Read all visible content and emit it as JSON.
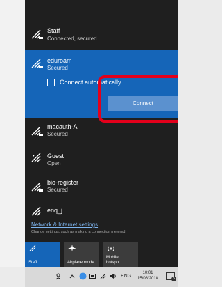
{
  "networks": [
    {
      "name": "Staff",
      "status": "Connected, secured"
    },
    {
      "name": "eduroam",
      "status": "Secured",
      "selected": true
    },
    {
      "name": "macauth-A",
      "status": "Secured"
    },
    {
      "name": "Guest",
      "status": "Open"
    },
    {
      "name": "bio-register",
      "status": "Secured"
    },
    {
      "name": "enq_j",
      "status": ""
    }
  ],
  "eduroam_panel": {
    "auto_connect_label": "Connect automatically",
    "auto_connect_checked": false,
    "connect_button": "Connect"
  },
  "settings": {
    "link": "Network & Internet settings",
    "description": "Change settings, such as making a connection metered."
  },
  "quick_actions": [
    {
      "label": "Staff",
      "icon": "wifi-icon",
      "active": true
    },
    {
      "label": "Airplane mode",
      "icon": "airplane-icon",
      "active": false
    },
    {
      "label": "Mobile\nhotspot",
      "icon": "hotspot-icon",
      "active": false
    }
  ],
  "taskbar": {
    "language": "ENG",
    "time": "10:01",
    "date": "15/08/2018",
    "notification_count": "5"
  },
  "colors": {
    "panel_bg": "#1f1f1f",
    "selected_bg": "#1565b8",
    "connect_button": "#5b91cf",
    "highlight": "#e3001b",
    "link": "#7db4ee"
  }
}
